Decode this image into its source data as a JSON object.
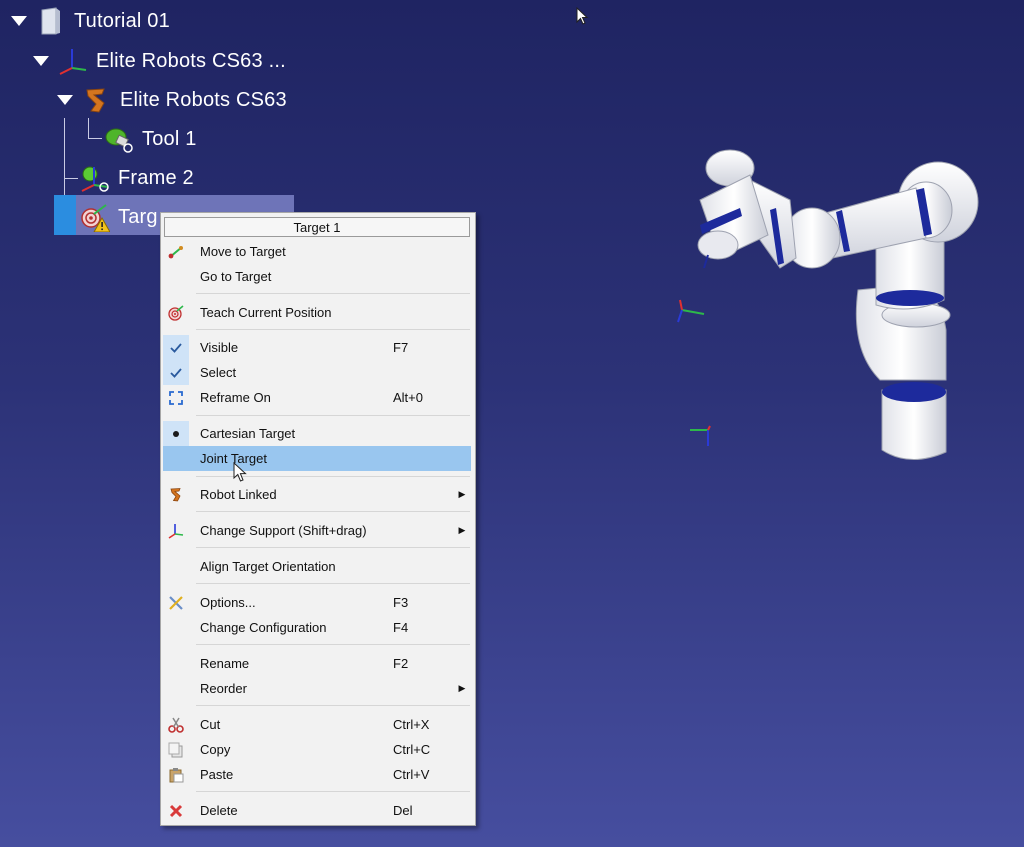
{
  "tree": {
    "items": [
      {
        "label": "Tutorial 01"
      },
      {
        "label": "Elite Robots CS63 ..."
      },
      {
        "label": "Elite Robots CS63"
      },
      {
        "label": "Tool 1"
      },
      {
        "label": "Frame 2"
      },
      {
        "label": "Targ"
      }
    ]
  },
  "menu": {
    "title": "Target 1",
    "items": [
      {
        "label": "Move to Target",
        "shortcut": "",
        "icon": "move-target-icon"
      },
      {
        "label": "Go to Target",
        "shortcut": ""
      },
      {
        "label": "Teach Current Position",
        "shortcut": "",
        "icon": "target-icon"
      },
      {
        "label": "Visible",
        "shortcut": "F7",
        "icon": "check-icon"
      },
      {
        "label": "Select",
        "shortcut": "",
        "icon": "check-icon"
      },
      {
        "label": "Reframe On",
        "shortcut": "Alt+0",
        "icon": "reframe-icon"
      },
      {
        "label": "Cartesian Target",
        "shortcut": "",
        "icon": "bullet-icon"
      },
      {
        "label": "Joint Target",
        "shortcut": ""
      },
      {
        "label": "Robot Linked",
        "shortcut": "",
        "icon": "robot-icon",
        "submenu": true
      },
      {
        "label": "Change Support (Shift+drag)",
        "shortcut": "",
        "icon": "axes-icon",
        "submenu": true
      },
      {
        "label": "Align Target Orientation",
        "shortcut": ""
      },
      {
        "label": "Options...",
        "shortcut": "F3",
        "icon": "options-icon"
      },
      {
        "label": "Change Configuration",
        "shortcut": "F4"
      },
      {
        "label": "Rename",
        "shortcut": "F2"
      },
      {
        "label": "Reorder",
        "shortcut": "",
        "submenu": true
      },
      {
        "label": "Cut",
        "shortcut": "Ctrl+X",
        "icon": "scissors-icon"
      },
      {
        "label": "Copy",
        "shortcut": "Ctrl+C",
        "icon": "copy-icon"
      },
      {
        "label": "Paste",
        "shortcut": "Ctrl+V",
        "icon": "paste-icon"
      },
      {
        "label": "Delete",
        "shortcut": "Del",
        "icon": "delete-icon"
      }
    ]
  },
  "colors": {
    "background_top": "#1f2462",
    "background_bottom": "#464e9f",
    "menu_highlight": "#99c6ef",
    "robot_accent": "#1d2a9c"
  }
}
